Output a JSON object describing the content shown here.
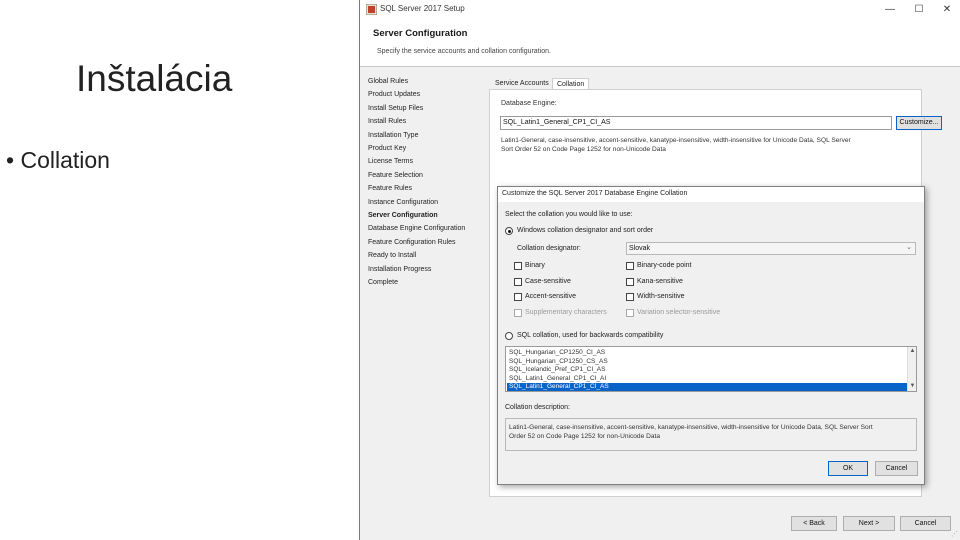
{
  "slide": {
    "title": "Inštalácia",
    "bullet_marker": "•",
    "bullet": "Collation"
  },
  "window": {
    "title": "SQL Server 2017 Setup",
    "min_glyph": "—",
    "max_glyph": "☐",
    "close_glyph": "✕",
    "header_title": "Server Configuration",
    "header_subtitle": "Specify the service accounts and collation configuration.",
    "steps": [
      "Global Rules",
      "Product Updates",
      "Install Setup Files",
      "Install Rules",
      "Installation Type",
      "Product Key",
      "License Terms",
      "Feature Selection",
      "Feature Rules",
      "Instance Configuration",
      "Server Configuration",
      "Database Engine Configuration",
      "Feature Configuration Rules",
      "Ready to Install",
      "Installation Progress",
      "Complete"
    ],
    "active_step": "Server Configuration",
    "tabs": [
      "Service Accounts",
      "Collation"
    ],
    "selected_tab": "Collation",
    "engine_label": "Database Engine:",
    "engine_value": "SQL_Latin1_General_CP1_CI_AS",
    "customize_label": "Customize...",
    "engine_desc_line1": "Latin1-General, case-insensitive, accent-sensitive, kanatype-insensitive, width-insensitive for Unicode Data, SQL Server",
    "engine_desc_line2": "Sort Order 52 on Code Page 1252 for non-Unicode Data",
    "back_label": "< Back",
    "next_label": "Next >",
    "cancel_label": "Cancel"
  },
  "dialog": {
    "title": "Customize the SQL Server 2017 Database Engine Collation",
    "prompt": "Select the collation you would like to use:",
    "windows_option": "Windows collation designator and sort order",
    "designator_label": "Collation designator:",
    "designator_value": "Slovak",
    "checkboxes": {
      "binary": "Binary",
      "binary_code_point": "Binary-code point",
      "case_sensitive": "Case-sensitive",
      "kana_sensitive": "Kana-sensitive",
      "accent_sensitive": "Accent-sensitive",
      "width_sensitive": "Width-sensitive",
      "supplementary": "Supplementary characters",
      "variation_selector": "Variation selector-sensitive"
    },
    "sql_option": "SQL collation, used for backwards compatibility",
    "sql_list": [
      "SQL_Hungarian_CP1250_CI_AS",
      "SQL_Hungarian_CP1250_CS_AS",
      "SQL_Icelandic_Pref_CP1_CI_AS",
      "SQL_Latin1_General_CP1_CI_AI",
      "SQL_Latin1_General_CP1_CI_AS"
    ],
    "selected_index": 4,
    "desc_label": "Collation description:",
    "desc_line1": "Latin1-General, case-insensitive, accent-sensitive, kanatype-insensitive, width-insensitive for Unicode Data, SQL Server Sort",
    "desc_line2": "Order 52 on Code Page 1252 for non-Unicode Data",
    "ok_label": "OK",
    "cancel_label": "Cancel",
    "scroll_up": "▲",
    "scroll_down": "▼",
    "dropdown_arrow": "⌄"
  }
}
